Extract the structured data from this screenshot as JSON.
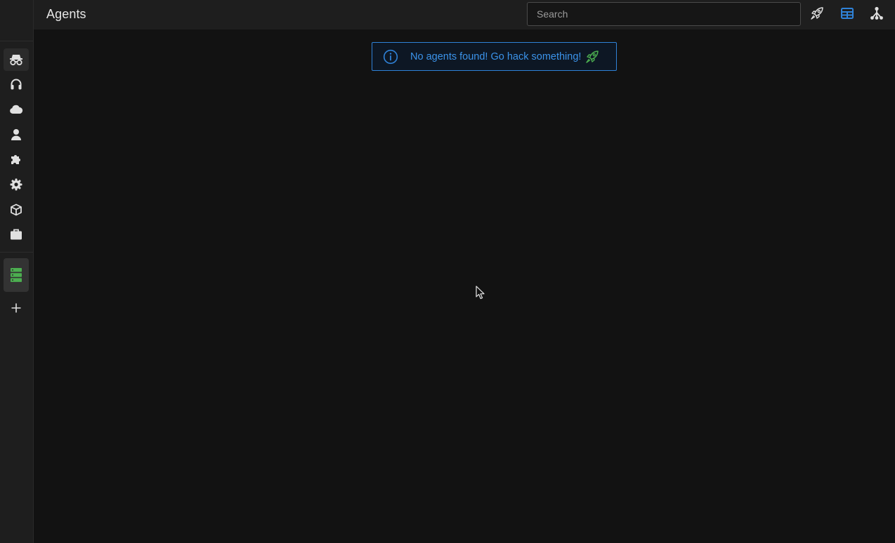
{
  "header": {
    "title": "Agents"
  },
  "search": {
    "placeholder": "Search",
    "value": ""
  },
  "sidebar": {
    "items": [
      {
        "name": "agents",
        "icon": "spy-icon"
      },
      {
        "name": "listeners",
        "icon": "headphones-icon"
      },
      {
        "name": "cloud",
        "icon": "cloud-icon"
      },
      {
        "name": "operators",
        "icon": "user-icon"
      },
      {
        "name": "extensions",
        "icon": "puzzle-icon"
      },
      {
        "name": "settings",
        "icon": "gear-icon"
      },
      {
        "name": "payloads",
        "icon": "cube-icon"
      },
      {
        "name": "loot",
        "icon": "briefcase-icon"
      }
    ],
    "server": {
      "icon": "server-icon"
    },
    "add": {
      "icon": "plus-icon"
    }
  },
  "toolbar": {
    "icons": [
      "rocket-icon",
      "table-view-icon",
      "graph-view-icon"
    ]
  },
  "alert": {
    "message": "No agents found! Go hack something!",
    "icon": "info-icon",
    "trailing_icon": "rocket-icon"
  },
  "colors": {
    "accent_blue": "#2f82d8",
    "alert_text": "#3b93ea",
    "server_green": "#4caf50",
    "background": "#121212",
    "panel": "#1e1e1e"
  }
}
